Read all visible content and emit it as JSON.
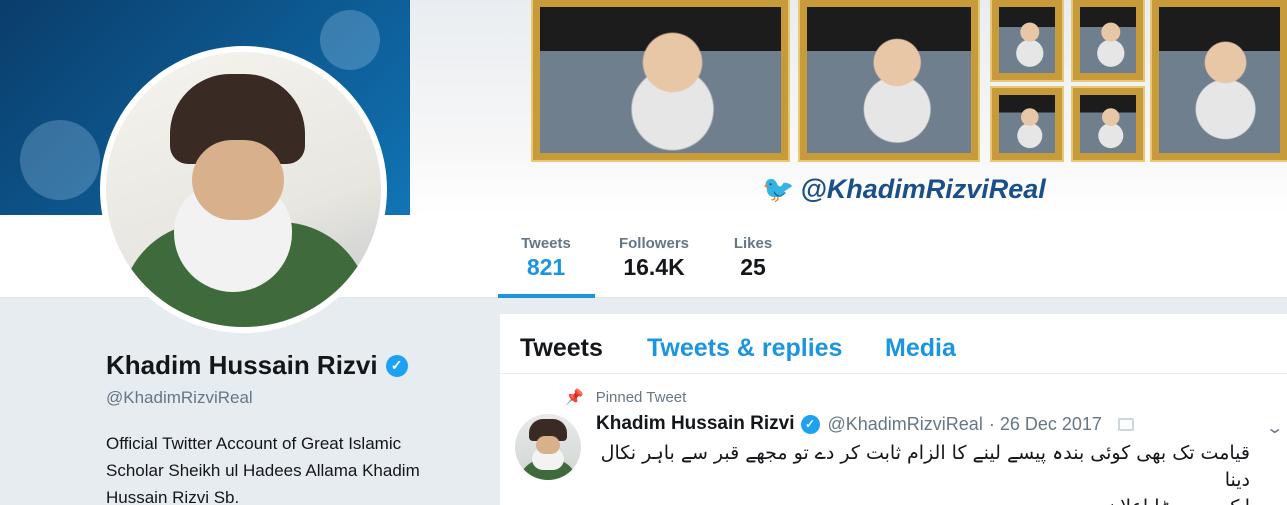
{
  "banner": {
    "handle": "@KhadimRizviReal",
    "bird_icon": "twitter-bird-icon"
  },
  "stats": [
    {
      "label": "Tweets",
      "value": "821"
    },
    {
      "label": "Followers",
      "value": "16.4K"
    },
    {
      "label": "Likes",
      "value": "25"
    }
  ],
  "profile": {
    "name": "Khadim Hussain Rizvi",
    "handle": "@KhadimRizviReal",
    "bio": "Official Twitter Account of Great Islamic Scholar Sheikh ul Hadees Allama Khadim Hussain Rizvi Sb."
  },
  "tabs": [
    {
      "label": "Tweets"
    },
    {
      "label": "Tweets & replies"
    },
    {
      "label": "Media"
    }
  ],
  "tweet": {
    "pinned_label": "Pinned Tweet",
    "author_name": "Khadim Hussain Rizvi",
    "author_handle": "@KhadimRizviReal",
    "date": "· 26 Dec 2017",
    "text_line1": "قیامت تک بھی کوئی بندہ پیسے لینے کا الزام ثابت کر دے تو مجھے قبر سے باہر نکال دینا",
    "text_line2": "ایک بہت بڑا اعلان"
  },
  "colors": {
    "accent": "#1b95e0",
    "verified": "#1da1f2",
    "text": "#14171a",
    "muted": "#657786"
  }
}
